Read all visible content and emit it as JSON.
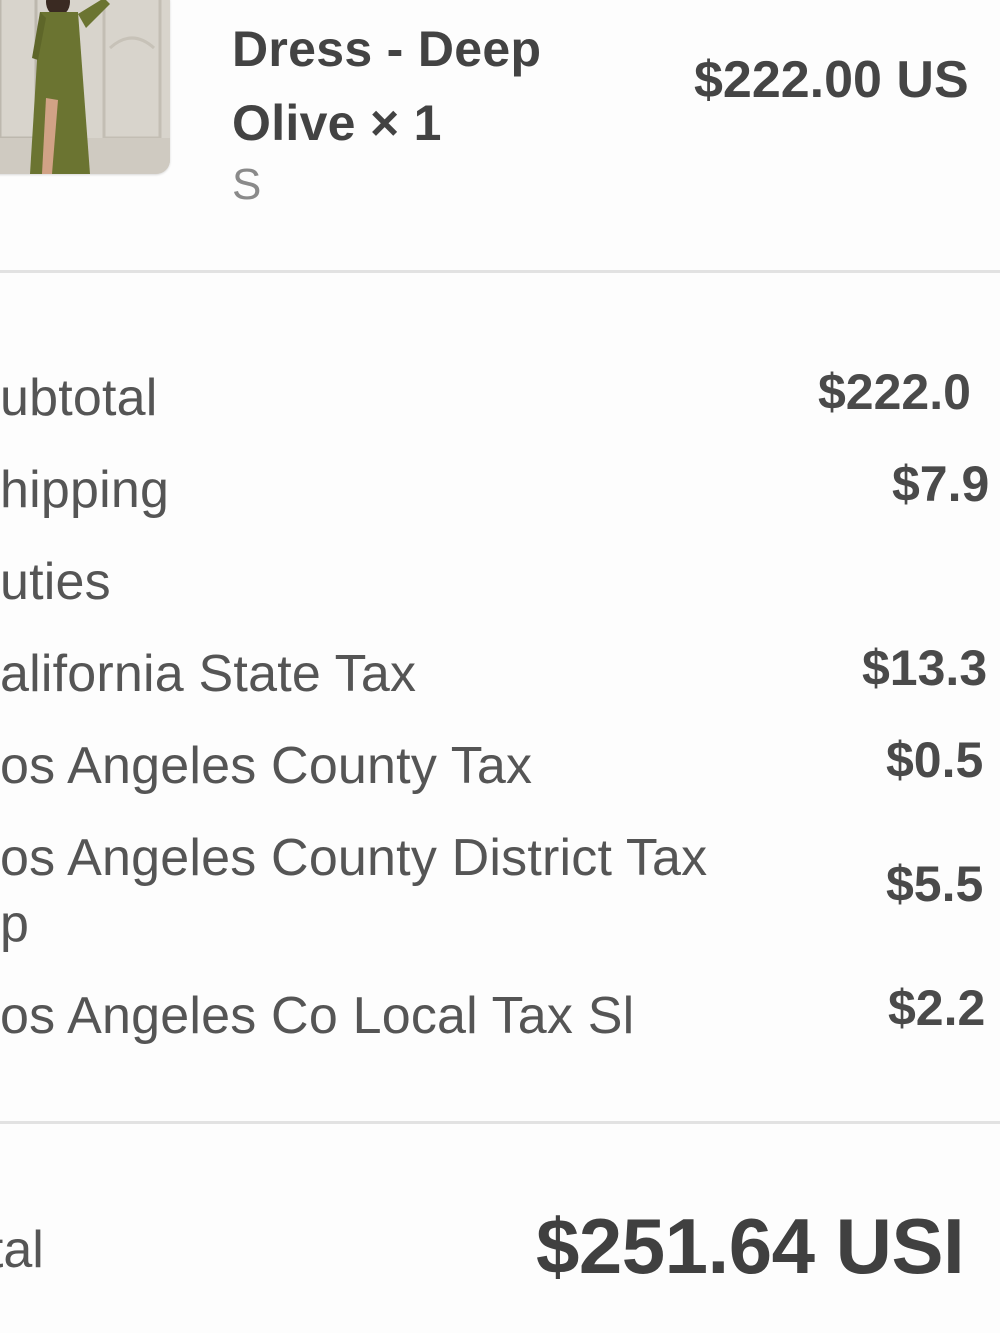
{
  "product": {
    "name": "Dress - Deep Olive × 1",
    "variant": "S",
    "price": "$222.00 US"
  },
  "summary": {
    "subtotal_label": "ubtotal",
    "subtotal_value": "$222.0",
    "shipping_label": "hipping",
    "shipping_value": "$7.9",
    "duties_label": "uties",
    "ca_tax_label": "alifornia State Tax",
    "ca_tax_value": "$13.3",
    "la_county_tax_label": "os Angeles County Tax",
    "la_county_tax_value": "$0.5",
    "la_district_tax_label_1": "os Angeles County District Tax",
    "la_district_tax_label_2": "p",
    "la_district_tax_value": "$5.5",
    "la_local_tax_label": "os Angeles Co Local Tax Sl",
    "la_local_tax_value": "$2.2"
  },
  "total": {
    "label": "otal",
    "value": "$251.64 USI"
  },
  "colors": {
    "text": "#4a4a4a",
    "muted": "#8a8a8a",
    "divider": "#e2e2e2",
    "dress": "#6b7431"
  }
}
